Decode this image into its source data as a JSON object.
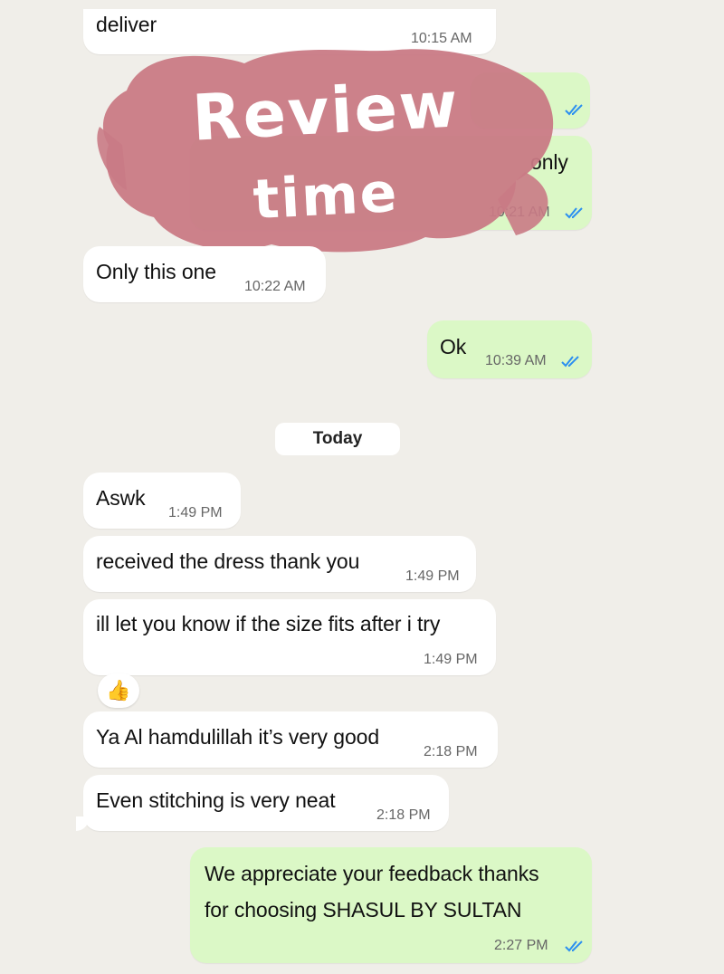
{
  "messages": [
    {
      "text": "deliver",
      "time": "10:15 AM"
    },
    {
      "text": "Only this one",
      "time": "10:22 AM"
    },
    {
      "text": "only",
      "time": "10:21 AM"
    },
    {
      "text": "Ok",
      "time": "10:39 AM"
    },
    {
      "text": "Aswk",
      "time": "1:49 PM"
    },
    {
      "text": "received the dress thank you",
      "time": "1:49 PM"
    },
    {
      "text": "ill let you know if the size fits after i try",
      "time": "1:49 PM"
    },
    {
      "text": "Ya Al hamdulillah it’s very good",
      "time": "2:18 PM"
    },
    {
      "text": "Even stitching is very neat",
      "time": "2:18 PM"
    },
    {
      "text_line1": "We appreciate your feedback thanks",
      "text_line2": "for choosing SHASUL BY SULTAN",
      "time": "2:27 PM"
    }
  ],
  "date_separator": "Today",
  "reaction_emoji": "👍",
  "sticker": {
    "line1": "Review",
    "line2": "time"
  },
  "colors": {
    "incoming": "#ffffff",
    "outgoing": "#dbf8c6",
    "background": "#f0eee9",
    "read_tick": "#2b8ff0",
    "sticker": "#c97a85"
  },
  "icons": {
    "read_receipt": "double-check-icon"
  }
}
